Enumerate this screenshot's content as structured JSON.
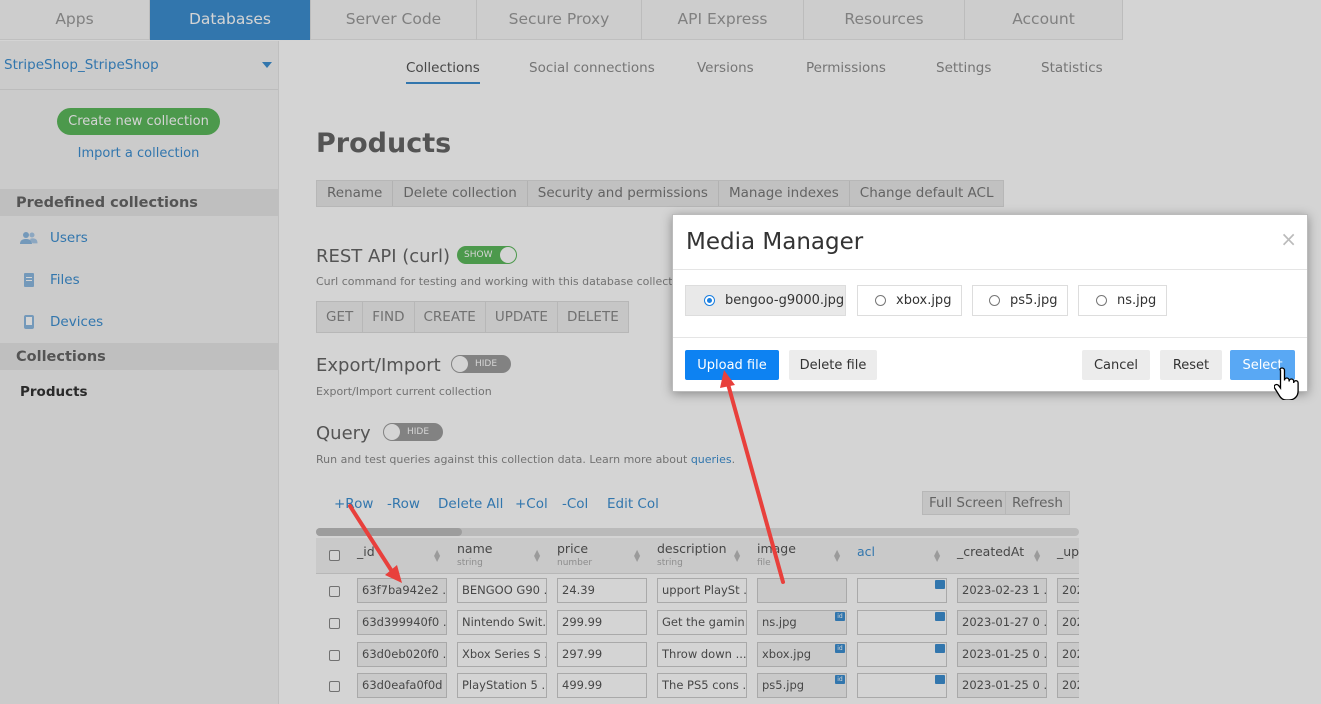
{
  "topnav": [
    "Apps",
    "Databases",
    "Server Code",
    "Secure Proxy",
    "API Express",
    "Resources",
    "Account"
  ],
  "sidebar": {
    "app_name": "StripeShop_StripeShop",
    "create_label": "Create new collection",
    "import_label": "Import a collection",
    "predefined_header": "Predefined collections",
    "predefined": [
      {
        "label": "Users",
        "icon": "users-icon"
      },
      {
        "label": "Files",
        "icon": "file-icon"
      },
      {
        "label": "Devices",
        "icon": "device-icon"
      }
    ],
    "collections_header": "Collections",
    "collections": [
      "Products"
    ]
  },
  "subnav": [
    "Collections",
    "Social connections",
    "Versions",
    "Permissions",
    "Settings",
    "Statistics"
  ],
  "main": {
    "title": "Products",
    "actions": [
      "Rename",
      "Delete collection",
      "Security and permissions",
      "Manage indexes",
      "Change default ACL"
    ],
    "rest": {
      "title": "REST API (curl)",
      "toggle": "SHOW",
      "desc": "Curl command for testing and working with this database collection."
    },
    "methods": [
      "GET",
      "FIND",
      "CREATE",
      "UPDATE",
      "DELETE"
    ],
    "export": {
      "title": "Export/Import",
      "toggle": "HIDE",
      "desc": "Export/Import current collection"
    },
    "query": {
      "title": "Query",
      "toggle": "HIDE",
      "desc": "Run and test queries against this collection data. Learn more about ",
      "link": "queries",
      "desc_end": "."
    },
    "table_links": [
      "+Row",
      "-Row",
      "Delete All",
      "+Col",
      "-Col",
      "Edit Col"
    ],
    "full_screen": "Full Screen",
    "refresh": "Refresh",
    "columns": [
      {
        "name": "_id",
        "type": ""
      },
      {
        "name": "name",
        "type": "string"
      },
      {
        "name": "price",
        "type": "number"
      },
      {
        "name": "description",
        "type": "string"
      },
      {
        "name": "image",
        "type": "file"
      },
      {
        "name": "acl",
        "type": ""
      },
      {
        "name": "_createdAt",
        "type": ""
      },
      {
        "name": "_upd",
        "type": ""
      }
    ],
    "rows": [
      [
        "63f7ba942e2 ...",
        "BENGOO G90 ...",
        "24.39",
        "upport PlaySt ...",
        "",
        "",
        "2023-02-23 1 ...",
        "202"
      ],
      [
        "63d399940f0 ...",
        "Nintendo Swit...",
        "299.99",
        "Get the gamin...",
        "ns.jpg",
        "",
        "2023-01-27 0 ...",
        "202"
      ],
      [
        "63d0eb020f0 ...",
        "Xbox Series S ...",
        "297.99",
        "Throw down ...",
        "xbox.jpg",
        "",
        "2023-01-25 0 ...",
        "202"
      ],
      [
        "63d0eafa0f0d ...",
        "PlayStation 5 ...",
        "499.99",
        "The PS5 cons ...",
        "ps5.jpg",
        "",
        "2023-01-25 0 ...",
        "202"
      ]
    ],
    "id_badge": "id"
  },
  "modal": {
    "title": "Media Manager",
    "close": "×",
    "files": [
      {
        "name": "bengoo-g9000.jpg",
        "selected": true
      },
      {
        "name": "xbox.jpg",
        "selected": false
      },
      {
        "name": "ps5.jpg",
        "selected": false
      },
      {
        "name": "ns.jpg",
        "selected": false
      }
    ],
    "upload": "Upload file",
    "delete": "Delete file",
    "cancel": "Cancel",
    "reset": "Reset",
    "select": "Select"
  },
  "colors": {
    "accent": "#3d8fd1",
    "primary": "#0d82f2",
    "arrow": "#e8403c",
    "success": "#5cb85c"
  }
}
